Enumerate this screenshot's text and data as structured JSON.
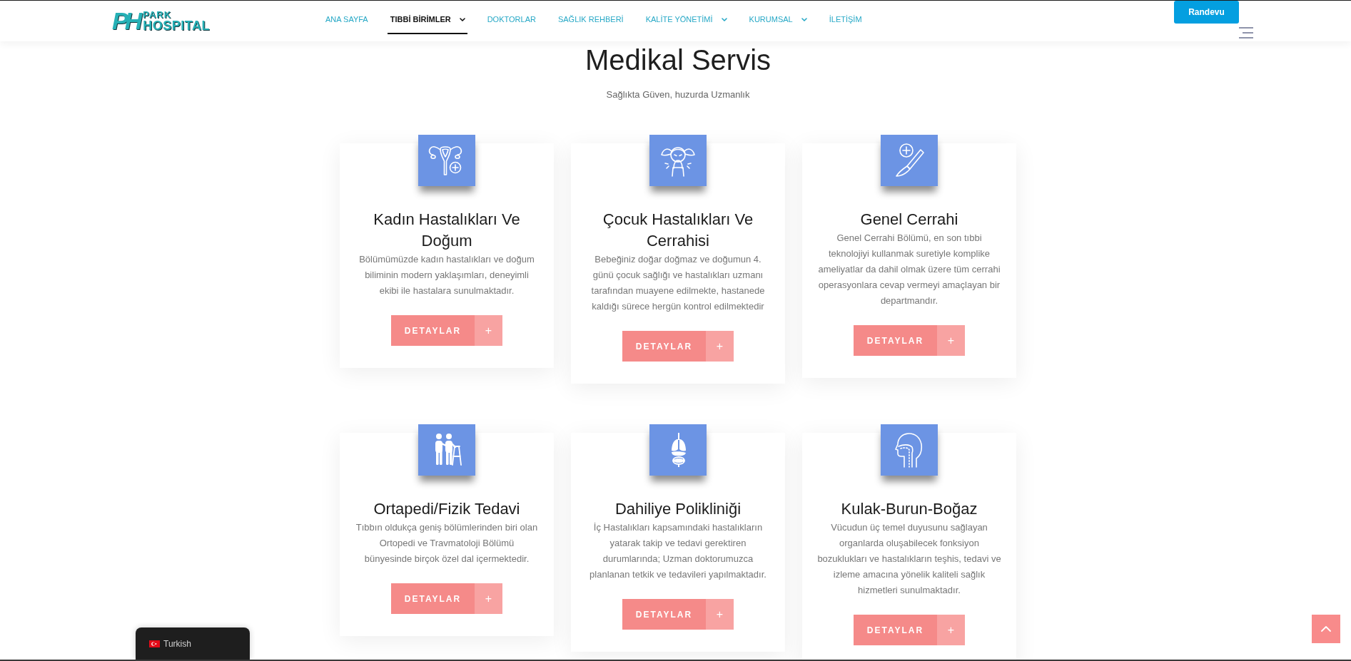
{
  "header": {
    "logo": {
      "mark": "PH",
      "top": "PARK",
      "bottom": "HOSPITAL"
    },
    "nav": [
      {
        "label": "ANA SAYFA",
        "selected": false,
        "dropdown": false
      },
      {
        "label": "TIBBİ BİRİMLER",
        "selected": true,
        "dropdown": true
      },
      {
        "label": "DOKTORLAR",
        "selected": false,
        "dropdown": false
      },
      {
        "label": "SAĞLIK REHBERİ",
        "selected": false,
        "dropdown": false
      },
      {
        "label": "KALİTE YÖNETİMİ",
        "selected": false,
        "dropdown": true
      },
      {
        "label": "KURUMSAL",
        "selected": false,
        "dropdown": true
      },
      {
        "label": "İLETİŞİM",
        "selected": false,
        "dropdown": false
      }
    ],
    "appointment_button": "Randevu"
  },
  "section": {
    "title": "Medikal Servis",
    "subtitle": "Sağlıkta Güven, huzurda Uzmanlık"
  },
  "services": [
    {
      "title": "Kadın Hastalıkları Ve Doğum",
      "description": "Bölümümüzde kadın hastalıkları ve doğum biliminin modern yaklaşımları, deneyimli ekibi ile hastalara sunulmaktadır.",
      "button": {
        "label": "DETAYLAR",
        "icon": "+"
      }
    },
    {
      "title": "Çocuk Hastalıkları Ve Cerrahisi",
      "description": "Bebeğiniz doğar doğmaz ve doğumun 4. günü çocuk sağlığı ve hastalıkları uzmanı tarafından muayene edilmekte, hastanede kaldığı sürece hergün kontrol edilmektedir",
      "button": {
        "label": "DETAYLAR",
        "icon": "+"
      }
    },
    {
      "title": "Genel Cerrahi",
      "description": "Genel Cerrahi Bölümü, en son tıbbi teknolojiyi kullanmak suretiyle komplike ameliyatlar da dahil olmak üzere tüm cerrahi operasyonlara cevap vermeyi amaçlayan bir departmandır.",
      "button": {
        "label": "DETAYLAR",
        "icon": "+"
      }
    },
    {
      "title": "Ortapedi/Fizik Tedavi",
      "description": "Tıbbın oldukça geniş bölümlerinden biri olan Ortopedi ve Travmatoloji Bölümü bünyesinde birçok özel dal içermektedir.",
      "button": {
        "label": "DETAYLAR",
        "icon": "+"
      }
    },
    {
      "title": "Dahiliye Polikliniği",
      "description": "İç Hastalıkları kapsamındaki hastalıkların yatarak takip ve tedavi gerektiren durumlarında; Uzman doktorumuzca planlanan tetkik ve tedavileri yapılmaktadır.",
      "button": {
        "label": "DETAYLAR",
        "icon": "+"
      }
    },
    {
      "title": "Kulak-Burun-Boğaz",
      "description": "Vücudun üç temel duyusunu sağlayan organlarda oluşabilecek fonksiyon bozuklukları ve hastalıkların teşhis, tedavi ve izleme amacına yönelik kaliteli sağlık hizmetleri sunulmaktadır.",
      "button": {
        "label": "DETAYLAR",
        "icon": "+"
      }
    }
  ],
  "language_switcher": {
    "label": "Turkish"
  }
}
